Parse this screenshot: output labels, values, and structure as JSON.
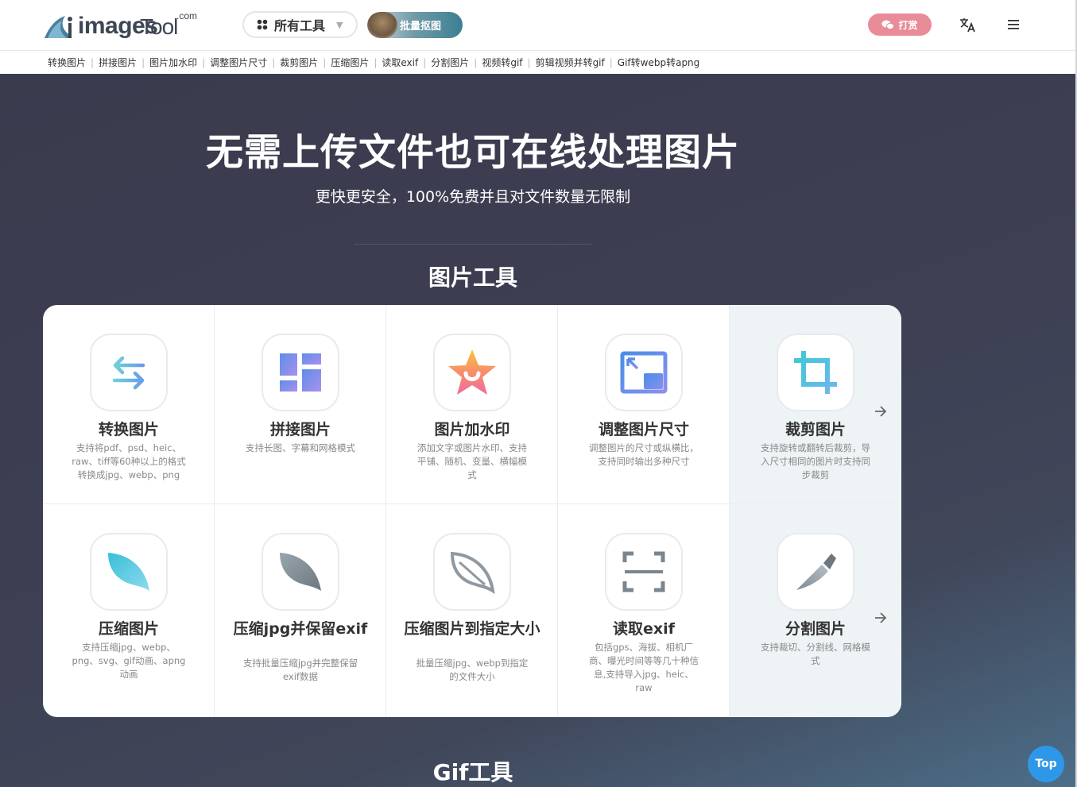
{
  "header": {
    "logo": {
      "word": "images",
      "tool": "Tool",
      "com": ".com"
    },
    "tools_button": "所有工具",
    "batch_button": "批量抠图",
    "reward_button": "打赏"
  },
  "subnav": [
    "转换图片",
    "拼接图片",
    "图片加水印",
    "调整图片尺寸",
    "裁剪图片",
    "压缩图片",
    "读取exif",
    "分割图片",
    "视频转gif",
    "剪辑视频并转gif",
    "Gif转webp转apng"
  ],
  "hero": {
    "title": "无需上传文件也可在线处理图片",
    "subtitle": "更快更安全，100%免费并且对文件数量无限制"
  },
  "sections": {
    "image_tools": "图片工具",
    "gif_tools": "Gif工具"
  },
  "tools": [
    {
      "title": "转换图片",
      "desc": "支持将pdf、psd、heic、raw、tiff等60种以上的格式转换成jpg、webp、png",
      "icon": "convert-arrows-icon"
    },
    {
      "title": "拼接图片",
      "desc": "支持长图、字幕和网格模式",
      "icon": "collage-grid-icon"
    },
    {
      "title": "图片加水印",
      "desc": "添加文字或图片水印、支持平铺、随机、变量、横幅模式",
      "icon": "watermark-star-icon"
    },
    {
      "title": "调整图片尺寸",
      "desc": "调整图片的尺寸或纵横比，支持同时输出多种尺寸",
      "icon": "resize-icon"
    },
    {
      "title": "裁剪图片",
      "desc": "支持旋转或翻转后裁剪，导入尺寸相同的图片时支持同步裁剪",
      "icon": "crop-icon"
    },
    {
      "title": "压缩图片",
      "desc": "支持压缩jpg、webp、png、svg、gif动画、apng动画",
      "icon": "feather-blue-icon"
    },
    {
      "title": "压缩jpg并保留exif",
      "desc": "支持批量压缩jpg并完整保留exif数据",
      "icon": "feather-gray-icon"
    },
    {
      "title": "压缩图片到指定大小",
      "desc": "批量压缩jpg、webp到指定的文件大小",
      "icon": "feather-outline-icon"
    },
    {
      "title": "读取exif",
      "desc": "包括gps、海拔、相机厂商、曝光时间等等几十种信息,支持导入jpg、heic、raw",
      "icon": "scan-frame-icon"
    },
    {
      "title": "分割图片",
      "desc": "支持裁切、分割线、网格模式",
      "icon": "knife-icon"
    }
  ],
  "top_button": "Top"
}
